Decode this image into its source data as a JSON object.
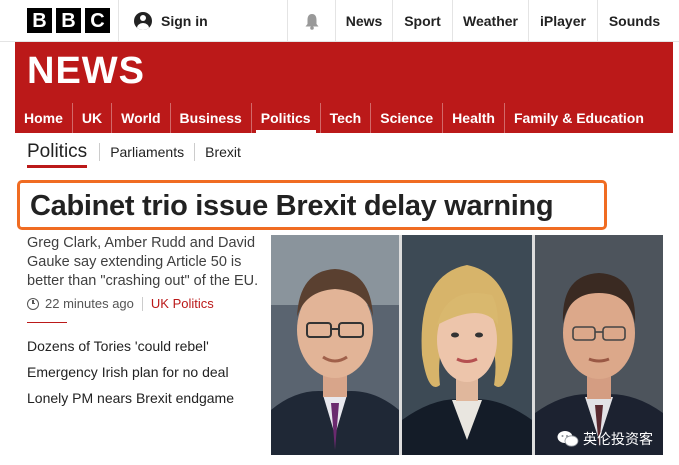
{
  "brand": {
    "letters": [
      "B",
      "B",
      "C"
    ]
  },
  "header": {
    "signin_label": "Sign in",
    "nav": [
      "News",
      "Sport",
      "Weather",
      "iPlayer",
      "Sounds"
    ]
  },
  "banner": {
    "title": "NEWS",
    "sections": [
      "Home",
      "UK",
      "World",
      "Business",
      "Politics",
      "Tech",
      "Science",
      "Health",
      "Family & Education"
    ],
    "active_section": "Politics"
  },
  "subnav": {
    "current": "Politics",
    "links": [
      "Parliaments",
      "Brexit"
    ]
  },
  "article": {
    "headline": "Cabinet trio issue Brexit delay warning",
    "summary": "Greg Clark, Amber Rudd and David Gauke say extending Article 50 is better than \"crashing out\" of the EU.",
    "time": "22 minutes ago",
    "tag": "UK Politics"
  },
  "related": [
    "Dozens of Tories 'could rebel'",
    "Emergency Irish plan for no deal",
    "Lonely PM nears Brexit endgame"
  ],
  "watermark": "英伦投资客",
  "colors": {
    "bbc_red": "#bb1919",
    "highlight": "#f06c22"
  }
}
